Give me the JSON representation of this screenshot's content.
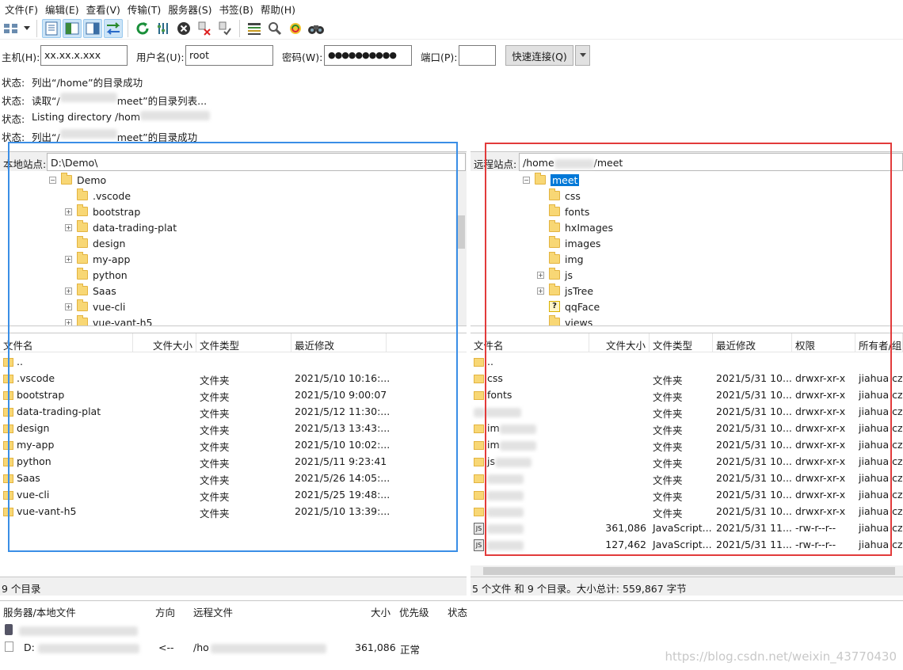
{
  "menu": [
    "文件(F)",
    "编辑(E)",
    "查看(V)",
    "传输(T)",
    "服务器(S)",
    "书签(B)",
    "帮助(H)"
  ],
  "toolbar_icons": [
    "site-manager-icon",
    "dropdown-arrow-icon",
    "toggle-log-icon",
    "toggle-local-tree-icon",
    "toggle-remote-tree-icon",
    "toggle-queue-icon",
    "refresh-icon",
    "process-queue-icon",
    "cancel-icon",
    "disconnect-icon",
    "reconnect-icon",
    "directory-listing-filters-icon",
    "search-icon",
    "sync-browse-icon",
    "binoculars-icon"
  ],
  "quickconnect": {
    "host_label": "主机(H):",
    "host_value": "xx.xx.x.xxx",
    "user_label": "用户名(U):",
    "user_value": "root",
    "pass_label": "密码(W):",
    "pass_value": "●●●●●●●●●●",
    "port_label": "端口(P):",
    "port_value": "",
    "connect_label": "快速连接(Q)"
  },
  "log": [
    {
      "k": "状态:",
      "a": "列出“/home”的目录成功",
      "b": ""
    },
    {
      "k": "状态:",
      "a": "读取“/",
      "b": "meet”的目录列表..."
    },
    {
      "k": "状态:",
      "a": "Listing directory /hom",
      "b": ""
    },
    {
      "k": "状态:",
      "a": "列出“/",
      "b": "meet”的目录成功"
    }
  ],
  "local": {
    "site_label": "本地站点:",
    "path": "D:\\Demo\\",
    "tree_root": "Demo",
    "tree": [
      {
        "name": ".vscode",
        "exp": false
      },
      {
        "name": "bootstrap",
        "exp": true
      },
      {
        "name": "data-trading-plat",
        "exp": true
      },
      {
        "name": "design",
        "exp": false
      },
      {
        "name": "my-app",
        "exp": true
      },
      {
        "name": "python",
        "exp": false
      },
      {
        "name": "Saas",
        "exp": true
      },
      {
        "name": "vue-cli",
        "exp": true
      },
      {
        "name": "vue-vant-h5",
        "exp": true
      }
    ],
    "headers": [
      "文件名",
      "文件大小",
      "文件类型",
      "最近修改"
    ],
    "rows": [
      {
        "name": "..",
        "size": "",
        "type": "",
        "mod": ""
      },
      {
        "name": ".vscode",
        "size": "",
        "type": "文件夹",
        "mod": "2021/5/10 10:16:..."
      },
      {
        "name": "bootstrap",
        "size": "",
        "type": "文件夹",
        "mod": "2021/5/10 9:00:07"
      },
      {
        "name": "data-trading-plat",
        "size": "",
        "type": "文件夹",
        "mod": "2021/5/12 11:30:..."
      },
      {
        "name": "design",
        "size": "",
        "type": "文件夹",
        "mod": "2021/5/13 13:43:..."
      },
      {
        "name": "my-app",
        "size": "",
        "type": "文件夹",
        "mod": "2021/5/10 10:02:..."
      },
      {
        "name": "python",
        "size": "",
        "type": "文件夹",
        "mod": "2021/5/11 9:23:41"
      },
      {
        "name": "Saas",
        "size": "",
        "type": "文件夹",
        "mod": "2021/5/26 14:05:..."
      },
      {
        "name": "vue-cli",
        "size": "",
        "type": "文件夹",
        "mod": "2021/5/25 19:48:..."
      },
      {
        "name": "vue-vant-h5",
        "size": "",
        "type": "文件夹",
        "mod": "2021/5/10 13:39:..."
      }
    ],
    "count": "9 个目录"
  },
  "remote": {
    "site_label": "远程站点:",
    "path_a": "/home",
    "path_b": "/meet",
    "tree_root": "meet",
    "tree": [
      {
        "name": "css",
        "exp": false,
        "q": false
      },
      {
        "name": "fonts",
        "exp": false,
        "q": false
      },
      {
        "name": "hxImages",
        "exp": false,
        "q": false
      },
      {
        "name": "images",
        "exp": false,
        "q": false
      },
      {
        "name": "img",
        "exp": false,
        "q": false
      },
      {
        "name": "js",
        "exp": true,
        "q": false
      },
      {
        "name": "jsTree",
        "exp": true,
        "q": false
      },
      {
        "name": "qqFace",
        "exp": false,
        "q": true
      },
      {
        "name": "views",
        "exp": false,
        "q": false
      }
    ],
    "headers": [
      "文件名",
      "文件大小",
      "文件类型",
      "最近修改",
      "权限",
      "所有者/组"
    ],
    "rows": [
      {
        "name": "..",
        "size": "",
        "type": "",
        "mod": "",
        "perm": "",
        "owner": "",
        "icon": "folder"
      },
      {
        "name": "css",
        "size": "",
        "type": "文件夹",
        "mod": "2021/5/31 10...",
        "perm": "drwxr-xr-x",
        "owner": "jiahua czh",
        "icon": "folder"
      },
      {
        "name": "fonts",
        "size": "",
        "type": "文件夹",
        "mod": "2021/5/31 10...",
        "perm": "drwxr-xr-x",
        "owner": "jiahua czh",
        "icon": "folder"
      },
      {
        "name": "",
        "size": "",
        "type": "文件夹",
        "mod": "2021/5/31 10...",
        "perm": "drwxr-xr-x",
        "owner": "jiahua czh",
        "icon": "blur"
      },
      {
        "name": "im",
        "size": "",
        "type": "文件夹",
        "mod": "2021/5/31 10...",
        "perm": "drwxr-xr-x",
        "owner": "jiahua czh",
        "icon": "folder"
      },
      {
        "name": "im",
        "size": "",
        "type": "文件夹",
        "mod": "2021/5/31 10...",
        "perm": "drwxr-xr-x",
        "owner": "jiahua czh",
        "icon": "folder"
      },
      {
        "name": "js",
        "size": "",
        "type": "文件夹",
        "mod": "2021/5/31 10...",
        "perm": "drwxr-xr-x",
        "owner": "jiahua czh",
        "icon": "folder"
      },
      {
        "name": "",
        "size": "",
        "type": "文件夹",
        "mod": "2021/5/31 10...",
        "perm": "drwxr-xr-x",
        "owner": "jiahua czh",
        "icon": "folder"
      },
      {
        "name": "",
        "size": "",
        "type": "文件夹",
        "mod": "2021/5/31 10...",
        "perm": "drwxr-xr-x",
        "owner": "jiahua czh",
        "icon": "folder"
      },
      {
        "name": "",
        "size": "",
        "type": "文件夹",
        "mod": "2021/5/31 10...",
        "perm": "drwxr-xr-x",
        "owner": "jiahua czh",
        "icon": "folder"
      },
      {
        "name": "",
        "size": "361,086",
        "type": "JavaScript...",
        "mod": "2021/5/31 11...",
        "perm": "-rw-r--r--",
        "owner": "jiahua czh",
        "icon": "js"
      },
      {
        "name": "",
        "size": "127,462",
        "type": "JavaScript...",
        "mod": "2021/5/31 11...",
        "perm": "-rw-r--r--",
        "owner": "jiahua czh",
        "icon": "js"
      }
    ],
    "count": "5 个文件 和 9 个目录。大小总计: 559,867 字节"
  },
  "queue": {
    "headers": [
      "服务器/本地文件",
      "方向",
      "远程文件",
      "大小",
      "优先级",
      "状态"
    ],
    "row2": {
      "local": "D:",
      "dir": "<--",
      "remote": "/ho",
      "size": "361,086",
      "prio": "正常"
    }
  },
  "watermark": "https://blog.csdn.net/weixin_43770430"
}
